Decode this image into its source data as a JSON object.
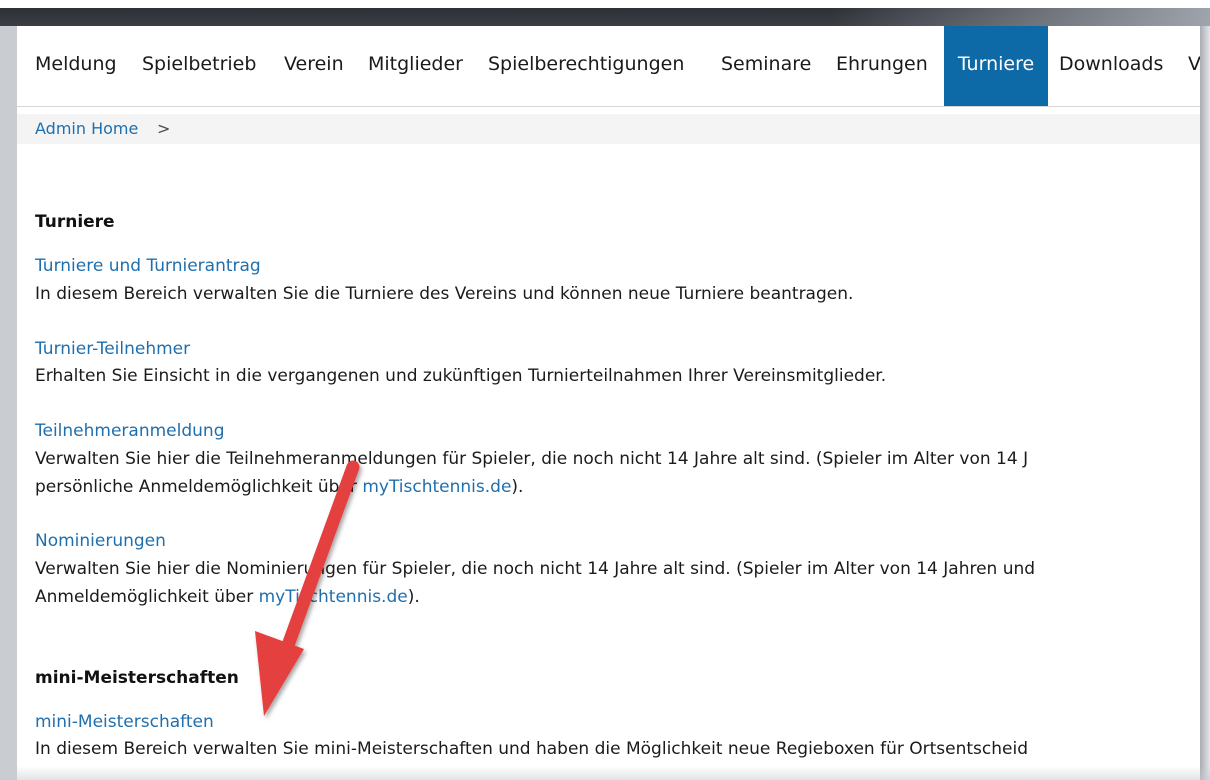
{
  "nav": {
    "items": [
      {
        "label": "Meldung"
      },
      {
        "label": "Spielbetrieb"
      },
      {
        "label": "Verein"
      },
      {
        "label": "Mitglieder"
      },
      {
        "label": "Spielberechtigungen"
      },
      {
        "label": "Seminare"
      },
      {
        "label": "Ehrungen"
      },
      {
        "label": "Turniere",
        "active": true
      },
      {
        "label": "Downloads"
      },
      {
        "label": "V"
      }
    ]
  },
  "breadcrumb": {
    "link": "Admin Home",
    "separator": ">"
  },
  "sections": {
    "turniere": {
      "title": "Turniere",
      "entries": [
        {
          "link": "Turniere und Turnierantrag",
          "description": "In diesem Bereich verwalten Sie die Turniere des Vereins und können neue Turniere beantragen."
        },
        {
          "link": "Turnier-Teilnehmer",
          "description": "Erhalten Sie Einsicht in die vergangenen und zukünftigen Turnierteilnahmen Ihrer Vereinsmitglieder."
        },
        {
          "link": "Teilnehmeranmeldung",
          "line1": "Verwalten Sie hier die Teilnehmeranmeldungen für Spieler, die noch nicht 14 Jahre alt sind. (Spieler im Alter von 14 J",
          "line2_pre": "persönliche Anmeldemöglichkeit über ",
          "line2_link": "myTischtennis.de",
          "line2_post": ")."
        },
        {
          "link": "Nominierungen",
          "line1": "Verwalten Sie hier die Nominierungen für Spieler, die noch nicht 14 Jahre alt sind. (Spieler im Alter von 14 Jahren und",
          "line2_pre": "Anmeldemöglichkeit über ",
          "line2_link": "myTischtennis.de",
          "line2_post": ")."
        }
      ]
    },
    "mini": {
      "title": "mini-Meisterschaften",
      "entries": [
        {
          "link": "mini-Meisterschaften",
          "description": "In diesem Bereich verwalten Sie mini-Meisterschaften und haben die Möglichkeit neue Regieboxen für Ortsentscheid"
        }
      ]
    }
  },
  "colors": {
    "nav_active_bg": "#0e6aa7",
    "link": "#1f6fae",
    "annotation_arrow": "#e5403f"
  }
}
